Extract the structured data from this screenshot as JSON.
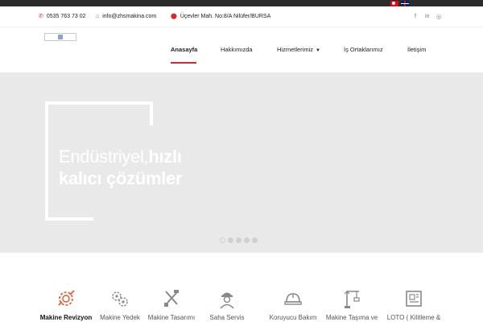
{
  "topbar": {
    "languages": [
      {
        "name": "Türkçe",
        "icon": "turkish-flag-icon"
      },
      {
        "name": "English",
        "icon": "uk-flag-icon"
      }
    ]
  },
  "contact": {
    "phone": "0535 763 73 02",
    "email": "info@zhsmakina.com",
    "address": "Üçevler Mah. No:8/A Nilüfer/BURSA",
    "social": {
      "facebook": "f",
      "linkedin": "in",
      "instagram": "◎"
    }
  },
  "nav": {
    "items": [
      {
        "label": "Anasayfa",
        "active": true
      },
      {
        "label": "Hakkımızda"
      },
      {
        "label": "Hizmetlerimiz",
        "dropdown": true
      },
      {
        "label": "İş Ortaklarımız"
      },
      {
        "label": "İletişim"
      }
    ]
  },
  "hero": {
    "line1_light": "Endüstriyel,",
    "line1_bold": "hızlı",
    "line2": "kalıcı çözümler",
    "slides": 5,
    "active_slide": 1
  },
  "services": [
    {
      "label": "Makine Revizyon",
      "icon": "gear-wrench-icon",
      "active": true
    },
    {
      "label": "Makine Yedek",
      "icon": "gears-icon"
    },
    {
      "label": "Makine Tasarımı",
      "icon": "tools-icon"
    },
    {
      "label": "Saha Servis",
      "icon": "worker-icon"
    },
    {
      "label": "Koruyucu Bakım",
      "icon": "hardhat-icon"
    },
    {
      "label": "Makine Taşıma ve",
      "icon": "crane-icon"
    },
    {
      "label": "LOTO ( Kilitleme &",
      "icon": "blueprint-icon"
    }
  ],
  "colors": {
    "accent": "#d6282e",
    "hero_bg": "#e9e9e9",
    "topbar": "#2b2b2b"
  }
}
